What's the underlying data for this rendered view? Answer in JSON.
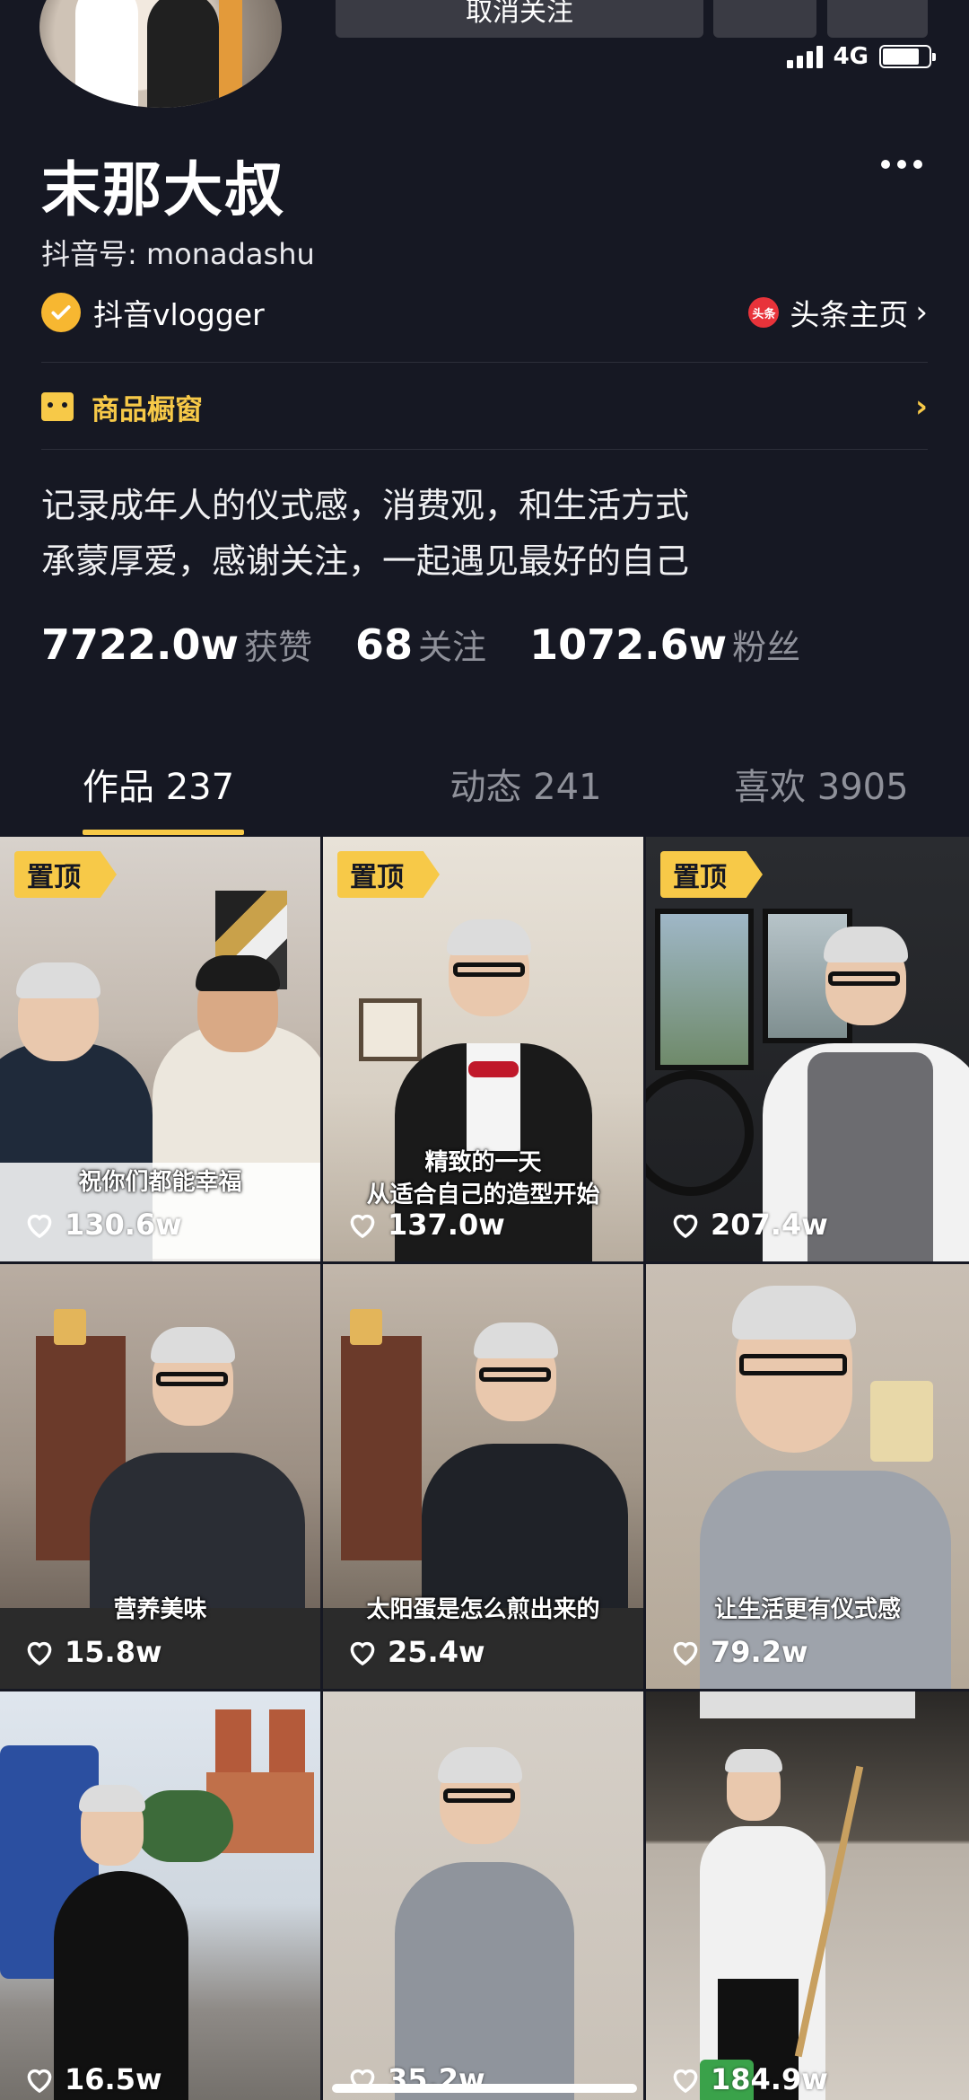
{
  "header": {
    "follow_button_label": "取消关注",
    "network": "4G"
  },
  "profile": {
    "name": "末那大叔",
    "douyin_id": "抖音号: monadashu",
    "verified_label": "抖音vlogger",
    "toutiao_badge": "头条",
    "toutiao_link": "头条主页",
    "shop_label": "商品橱窗",
    "bio_lines": [
      "记录成年人的仪式感，消费观，和生活方式",
      "承蒙厚爱，感谢关注，一起遇见最好的自己"
    ],
    "stats": [
      {
        "value": "7722.0w",
        "label": "获赞"
      },
      {
        "value": "68",
        "label": "关注"
      },
      {
        "value": "1072.6w",
        "label": "粉丝"
      }
    ]
  },
  "tabs": [
    {
      "label": "作品 237",
      "active": true
    },
    {
      "label": "动态 241",
      "active": false
    },
    {
      "label": "喜欢 3905",
      "active": false
    }
  ],
  "videos": [
    {
      "pinned": "置顶",
      "caption": "祝你们都能幸福",
      "likes": "130.6w"
    },
    {
      "pinned": "置顶",
      "caption": "精致的一天\n从适合自己的造型开始",
      "likes": "137.0w"
    },
    {
      "pinned": "置顶",
      "caption": "",
      "likes": "207.4w"
    },
    {
      "pinned": "",
      "caption": "营养美味",
      "likes": "15.8w"
    },
    {
      "pinned": "",
      "caption": "太阳蛋是怎么煎出来的",
      "likes": "25.4w"
    },
    {
      "pinned": "",
      "caption": "让生活更有仪式感",
      "likes": "79.2w"
    },
    {
      "pinned": "",
      "caption": "",
      "likes": "16.5w"
    },
    {
      "pinned": "",
      "caption": "",
      "likes": "35.2w"
    },
    {
      "pinned": "",
      "caption": "",
      "likes": "184.9w"
    }
  ],
  "colors": {
    "background": "#161823",
    "accent": "#f7c948",
    "muted_text": "#8f919a"
  }
}
